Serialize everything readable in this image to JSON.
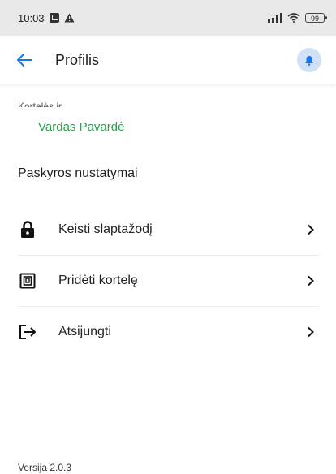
{
  "status_bar": {
    "time": "10:03",
    "battery": "99"
  },
  "app_bar": {
    "title": "Profilis",
    "back_icon": "arrow-left-icon",
    "notification_icon": "bell-icon",
    "accent_color": "#1a73e8",
    "notification_bg": "#cfe0f7"
  },
  "profile": {
    "partial_label": "Kortelės ir ...",
    "name": "Vardas Pavardė",
    "name_color": "#27a04a"
  },
  "settings": {
    "title": "Paskyros nustatymai",
    "items": [
      {
        "label": "Keisti slaptažodį",
        "icon": "lock-icon"
      },
      {
        "label": "Pridėti kortelę",
        "icon": "card-icon"
      },
      {
        "label": "Atsijungti",
        "icon": "logout-icon"
      }
    ]
  },
  "footer": {
    "version": "Versija 2.0.3"
  }
}
